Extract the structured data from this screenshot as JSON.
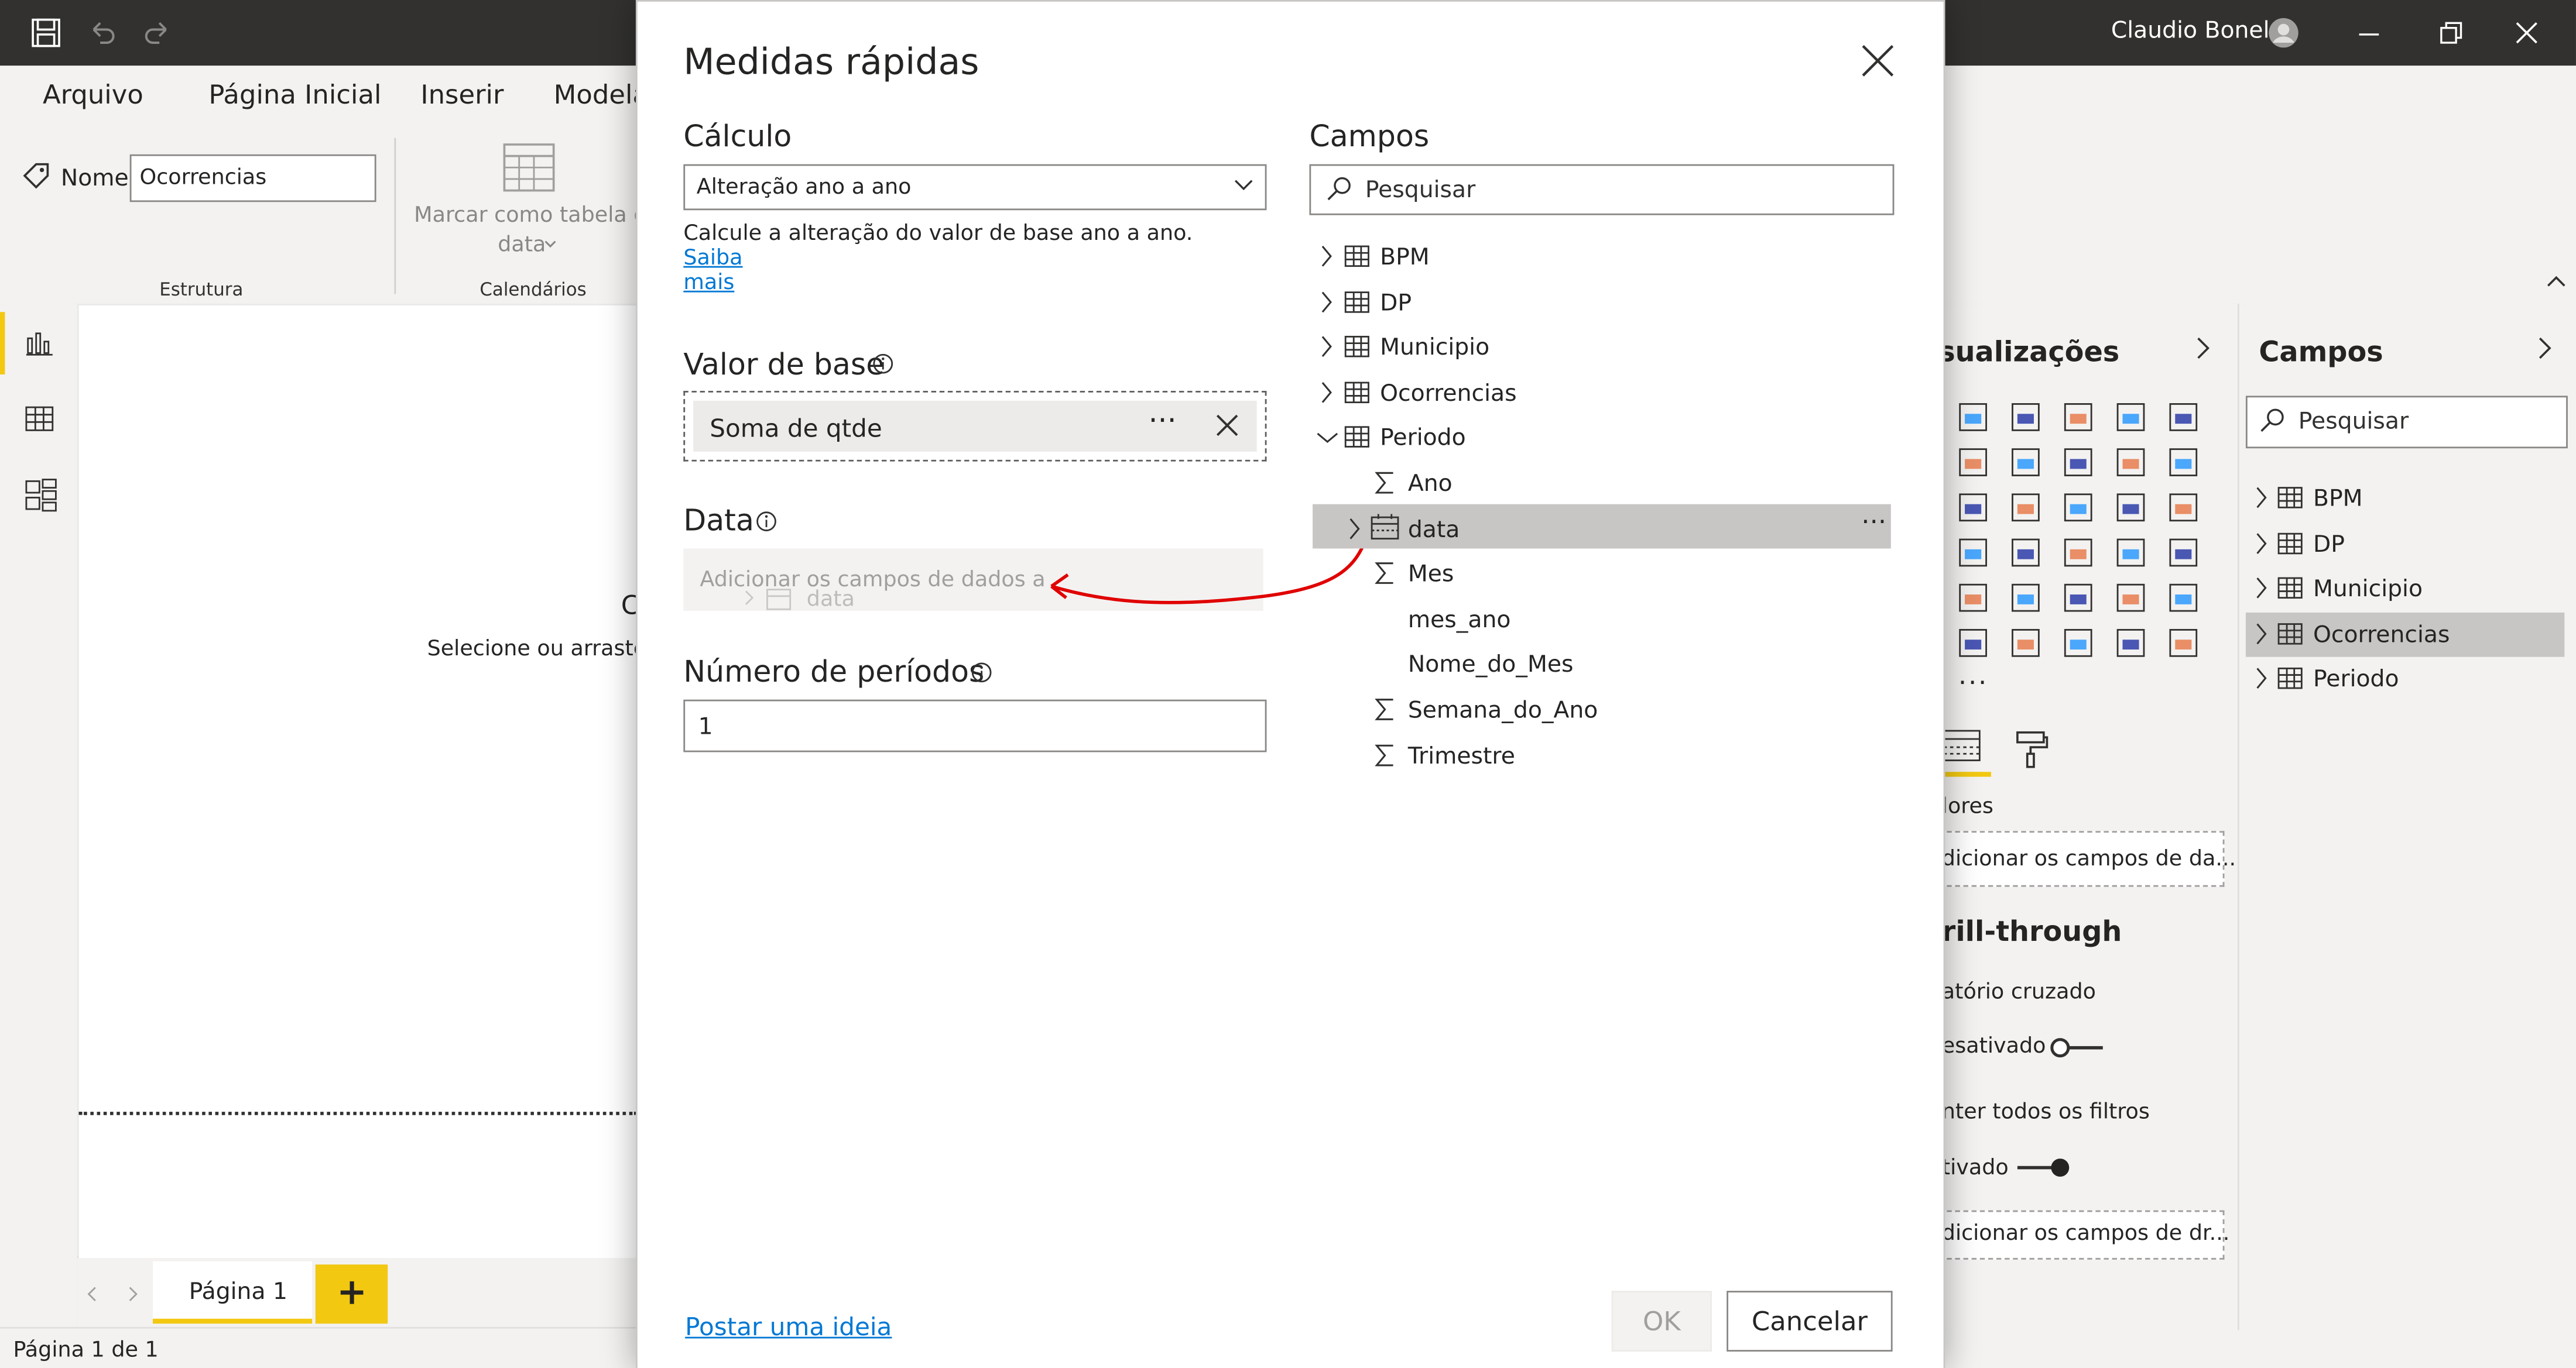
{
  "titlebar": {
    "user_name": "Claudio Bonel"
  },
  "ribbon": {
    "tabs": [
      "Arquivo",
      "Página Inicial",
      "Inserir",
      "Modela"
    ],
    "name_label": "Nome",
    "name_value": "Ocorrencias",
    "mark_date_table_line1": "Marcar como tabela d",
    "mark_date_table_line2": "data",
    "group_structure": "Estrutura",
    "group_calendars": "Calendários"
  },
  "canvas": {
    "hint_letter": "C",
    "hint_text": "Selecione ou arraste",
    "page_tab": "Página 1",
    "add_page": "+"
  },
  "statusbar": {
    "page_info": "Página 1 de 1"
  },
  "viz_pane": {
    "title": "sualizações",
    "more": "···",
    "values_label": "lores",
    "values_placeholder": "dicionar os campos de da...",
    "drillthrough_title": "rill-through",
    "cross_report_label": "atório cruzado",
    "toggle1_label": "esativado",
    "keep_filters_label": "nter todos os filtros",
    "toggle2_label": "tivado",
    "drill_placeholder": "dicionar os campos de dr..."
  },
  "fields_pane": {
    "title": "Campos",
    "search_placeholder": "Pesquisar",
    "tables": [
      "BPM",
      "DP",
      "Municipio",
      "Ocorrencias",
      "Periodo"
    ],
    "selected_table": "Ocorrencias"
  },
  "dialog": {
    "title": "Medidas rápidas",
    "calc_label": "Cálculo",
    "calc_value": "Alteração ano a ano",
    "calc_desc": "Calcule a alteração do valor de base ano a ano.",
    "calc_link_1": "Saiba",
    "calc_link_2": "mais",
    "base_label": "Valor de base",
    "base_value": "Soma de qtde",
    "base_more": "···",
    "date_label": "Data",
    "date_placeholder": "Adicionar os campos de dados a",
    "drag_ghost": "data",
    "periods_label": "Número de períodos",
    "periods_value": "1",
    "fields_label": "Campos",
    "fields_search_placeholder": "Pesquisar",
    "tree": [
      {
        "label": "BPM",
        "kind": "table"
      },
      {
        "label": "DP",
        "kind": "table"
      },
      {
        "label": "Municipio",
        "kind": "table"
      },
      {
        "label": "Ocorrencias",
        "kind": "table"
      },
      {
        "label": "Periodo",
        "kind": "table-open"
      },
      {
        "label": "Ano",
        "kind": "sum"
      },
      {
        "label": "data",
        "kind": "date"
      },
      {
        "label": "Mes",
        "kind": "sum"
      },
      {
        "label": "mes_ano",
        "kind": "text"
      },
      {
        "label": "Nome_do_Mes",
        "kind": "text"
      },
      {
        "label": "Semana_do_Ano",
        "kind": "sum"
      },
      {
        "label": "Trimestre",
        "kind": "sum"
      }
    ],
    "tree_more": "···",
    "idea_link": "Postar uma ideia",
    "ok_label": "OK",
    "cancel_label": "Cancelar"
  },
  "colors": {
    "titlebar": "#323130",
    "accent_yellow": "#f2c811",
    "link_blue": "#0078d4",
    "selected_row": "#c8c6c4",
    "arrow_red": "#e00000"
  }
}
